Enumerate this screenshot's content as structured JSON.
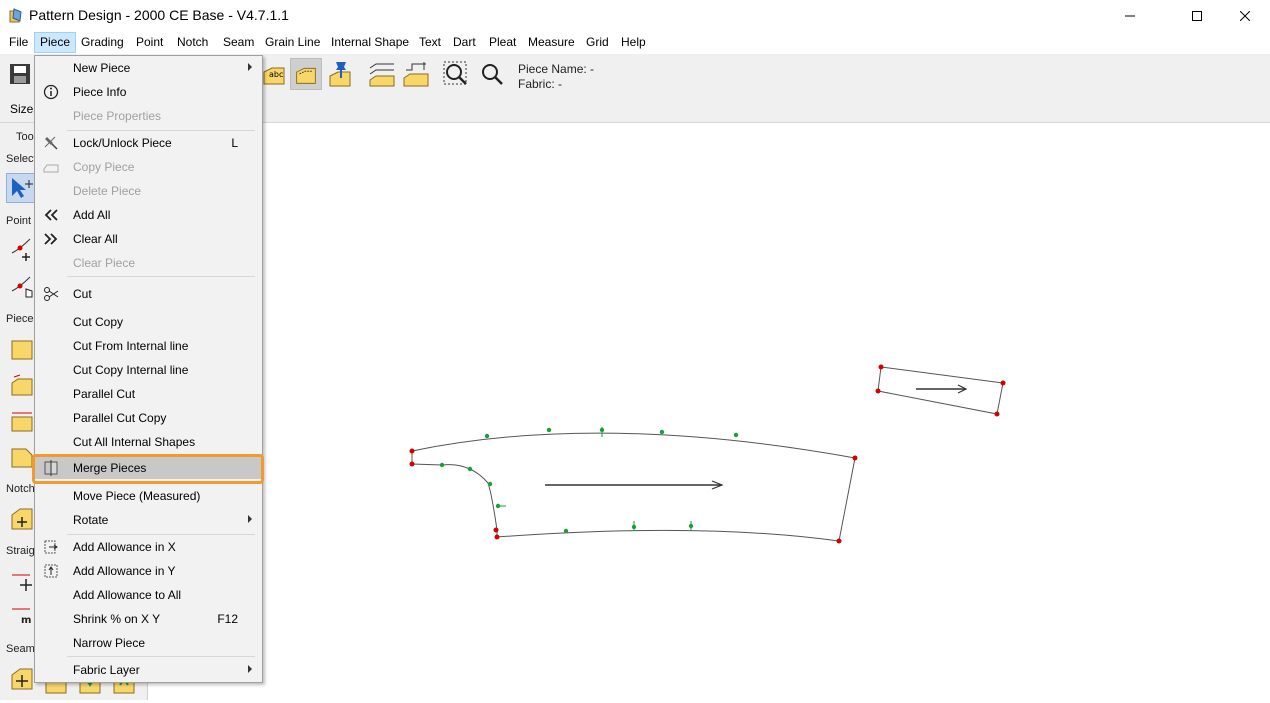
{
  "window": {
    "title": "Pattern Design - 2000 CE Base - V4.7.1.1"
  },
  "menubar": {
    "items": [
      "File",
      "Piece",
      "Grading",
      "Point",
      "Notch",
      "Seam",
      "Grain Line",
      "Internal Shape",
      "Text",
      "Dart",
      "Pleat",
      "Measure",
      "Grid",
      "Help"
    ]
  },
  "toolbar": {
    "piece_name": "Piece Name: -",
    "fabric": "Fabric: -",
    "sizes_label": "Sizes"
  },
  "left_panel": {
    "tools_label": "Too",
    "select_label": "Select",
    "point_label": "Point",
    "piece_label": "Piece",
    "notch_label": "Notch",
    "straight_label": "Straig",
    "seam_label": "Seam"
  },
  "piece_menu": {
    "items": [
      {
        "label": "New Piece",
        "submenu": true
      },
      {
        "label": "Piece Info",
        "icon": "info-icon"
      },
      {
        "label": "Piece Properties",
        "disabled": true
      },
      {
        "label": "Lock/Unlock Piece",
        "shortcut": "L",
        "icon": "pin-icon"
      },
      {
        "label": "Copy Piece",
        "disabled": true,
        "icon": "copy-piece-icon"
      },
      {
        "label": "Delete Piece",
        "disabled": true
      },
      {
        "label": "Add All",
        "icon": "double-chevron-left-icon"
      },
      {
        "label": "Clear All",
        "icon": "double-chevron-right-icon"
      },
      {
        "label": "Clear Piece",
        "disabled": true
      },
      {
        "label": "Cut",
        "icon": "scissors-icon"
      },
      {
        "label": "Cut  Copy"
      },
      {
        "label": "Cut From Internal line"
      },
      {
        "label": "Cut  Copy Internal line"
      },
      {
        "label": "Parallel Cut"
      },
      {
        "label": "Parallel Cut  Copy"
      },
      {
        "label": "Cut All Internal Shapes"
      },
      {
        "label": "Merge Pieces",
        "icon": "merge-icon",
        "highlighted": true
      },
      {
        "label": "Move Piece (Measured)"
      },
      {
        "label": "Rotate",
        "submenu": true
      },
      {
        "label": "Add Allowance in X",
        "icon": "allowance-x-icon"
      },
      {
        "label": "Add Allowance in Y",
        "icon": "allowance-y-icon"
      },
      {
        "label": "Add Allowance to All"
      },
      {
        "label": "Shrink % on X  Y",
        "shortcut": "F12"
      },
      {
        "label": "Narrow Piece"
      },
      {
        "label": "Fabric Layer",
        "submenu": true
      }
    ]
  },
  "colors": {
    "accent_highlight": "#f39a2e",
    "point_red": "#d40000",
    "point_green": "#1a9e3a",
    "menu_active": "#cce8ff",
    "tool_yellow": "#f8d66a"
  }
}
